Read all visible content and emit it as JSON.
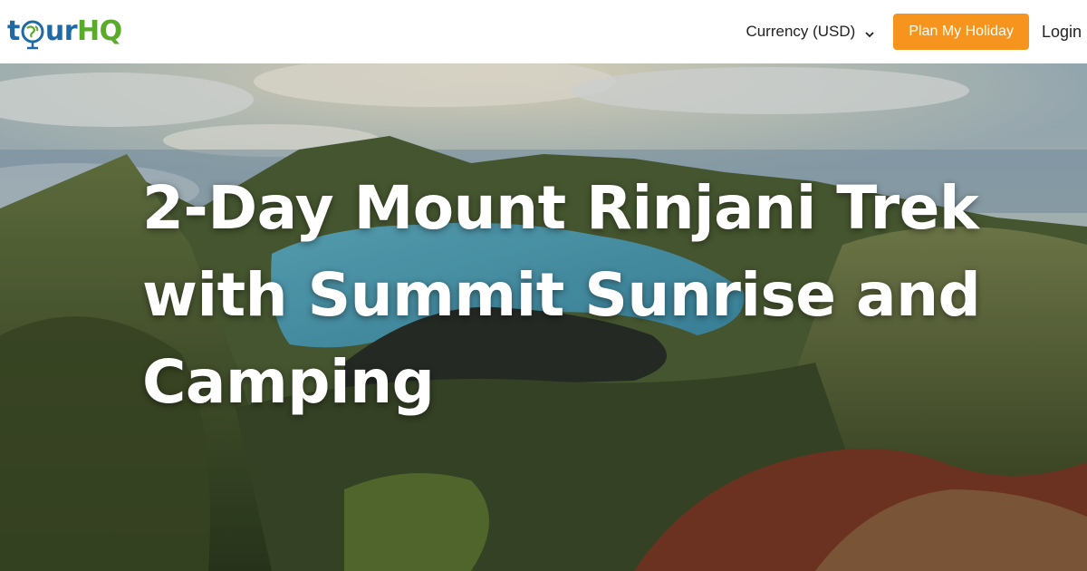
{
  "header": {
    "logo": {
      "part_t": "t",
      "part_ur": "ur",
      "part_hq": "HQ",
      "brand_blue": "#1f6aa5",
      "brand_green": "#5aaa2b"
    },
    "currency_label": "Currency (USD)",
    "plan_button_label": "Plan My Holiday",
    "plan_button_color": "#f7941d",
    "login_label": "Login"
  },
  "hero": {
    "title": "2-Day Mount Rinjani Trek with Summit Sunrise and Camping"
  }
}
